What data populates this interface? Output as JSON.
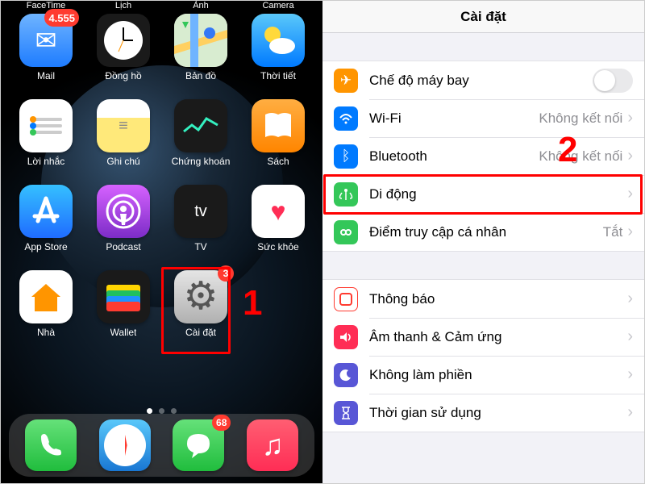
{
  "home": {
    "top_labels": [
      "FaceTime",
      "Lịch",
      "Ảnh",
      "Camera"
    ],
    "apps": [
      {
        "label": "Mail",
        "badge": "4.555",
        "icon": "✉"
      },
      {
        "label": "Đồng hồ",
        "icon": "clock"
      },
      {
        "label": "Bản đồ",
        "icon": "map"
      },
      {
        "label": "Thời tiết",
        "icon": "☀"
      },
      {
        "label": "Lời nhắc",
        "icon": "reminders"
      },
      {
        "label": "Ghi chú",
        "icon": "notes"
      },
      {
        "label": "Chứng khoán",
        "icon": "stocks"
      },
      {
        "label": "Sách",
        "icon": "book"
      },
      {
        "label": "App Store",
        "icon": "A"
      },
      {
        "label": "Podcast",
        "icon": "◎"
      },
      {
        "label": "TV",
        "icon": "tv"
      },
      {
        "label": "Sức khỏe",
        "icon": "♥"
      },
      {
        "label": "Nhà",
        "icon": "⌂"
      },
      {
        "label": "Wallet",
        "icon": "wallet"
      },
      {
        "label": "Cài đặt",
        "badge": "3",
        "icon": "gear"
      }
    ],
    "dock": [
      {
        "name": "phone",
        "icon": "✆"
      },
      {
        "name": "safari",
        "icon": "safari"
      },
      {
        "name": "messages",
        "icon": "✉",
        "badge": "68"
      },
      {
        "name": "music",
        "icon": "♫"
      }
    ],
    "page_dots": {
      "count": 3,
      "active": 0
    }
  },
  "settings": {
    "title": "Cài đặt",
    "group1": [
      {
        "icon": "✈",
        "label": "Chế độ máy bay",
        "control": "toggle",
        "state": "off"
      },
      {
        "icon": "wifi",
        "label": "Wi-Fi",
        "detail": "Không kết nối"
      },
      {
        "icon": "bt",
        "label": "Bluetooth",
        "detail": "Không kết nối"
      },
      {
        "icon": "cell",
        "label": "Di động",
        "detail": ""
      },
      {
        "icon": "link",
        "label": "Điểm truy cập cá nhân",
        "detail": "Tắt"
      }
    ],
    "group2": [
      {
        "icon": "notif",
        "label": "Thông báo"
      },
      {
        "icon": "sound",
        "label": "Âm thanh & Cảm ứng"
      },
      {
        "icon": "dnd",
        "label": "Không làm phiền"
      },
      {
        "icon": "st",
        "label": "Thời gian sử dụng"
      }
    ]
  },
  "callouts": {
    "one": "1",
    "two": "2"
  }
}
